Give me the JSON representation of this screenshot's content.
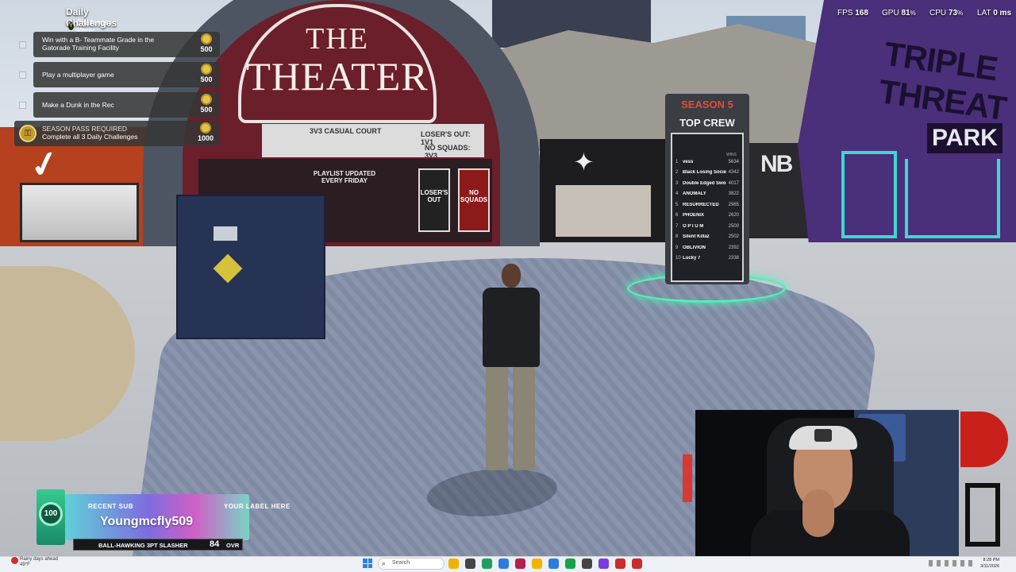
{
  "challenges": {
    "title": "Daily Challenges",
    "menu_button": "Y",
    "menu_label": "Challenges Menu",
    "items": [
      {
        "line1": "Win with a B- Teammate Grade in the",
        "line2": "Gatorade Training Facility",
        "reward": "500"
      },
      {
        "line1": "Play a multiplayer game",
        "line2": "",
        "reward": "500"
      },
      {
        "line1": "Make a Dunk in the Rec",
        "line2": "",
        "reward": "500"
      }
    ],
    "season_pass": {
      "title": "SEASON PASS REQUIRED",
      "description": "Complete all 3 Daily Challenges",
      "reward": "1000"
    }
  },
  "perf": {
    "fps_label": "FPS",
    "fps_value": "168",
    "gpu_label": "GPU",
    "gpu_value": "81",
    "cpu_label": "CPU",
    "cpu_value": "73",
    "lat_label": "LAT",
    "lat_value": "0",
    "percent": "%",
    "ms": "ms"
  },
  "scene": {
    "theater_the": "THE",
    "theater_name": "THEATER",
    "marquee_1": "3V3 CASUAL COURT",
    "marquee_2": "LOSER'S OUT: 1V1",
    "marquee_3": "NO SQUADS: 3V3",
    "playlist_1": "PLAYLIST UPDATED",
    "playlist_2": "EVERY FRIDAY",
    "poster_losers": "LOSER'S OUT",
    "poster_noscope": "NO SQUADS",
    "triple_threat": "TRIPLE THREAT",
    "park": "PARK",
    "nb_logo": "NB",
    "jordan_logo": "✦",
    "board_season": "SEASON 5",
    "board_title": "TOP CREW",
    "board_score_header": "WINS",
    "crews": [
      {
        "rank": "1",
        "name": "vess",
        "score": "5634"
      },
      {
        "rank": "2",
        "name": "Black Losing Society",
        "score": "4342"
      },
      {
        "rank": "3",
        "name": "Double Edged Sword",
        "score": "4017"
      },
      {
        "rank": "4",
        "name": "ANOMALY",
        "score": "3822"
      },
      {
        "rank": "5",
        "name": "RESURRECTED",
        "score": "2965"
      },
      {
        "rank": "6",
        "name": "PHOENIX",
        "score": "2620"
      },
      {
        "rank": "7",
        "name": "O P I U M",
        "score": "2500"
      },
      {
        "rank": "8",
        "name": "Silent Killaz",
        "score": "2502"
      },
      {
        "rank": "9",
        "name": "OBLIVION",
        "score": "2392"
      },
      {
        "rank": "10",
        "name": "Lucky 7",
        "score": "2338"
      }
    ]
  },
  "alert": {
    "badge": "100",
    "recent_sub": "RECENT SUB",
    "username": "Youngmcfly509",
    "your_label": "YOUR LABEL HERE",
    "player_build": "BALL-HAWKING 3PT SLASHER",
    "ovr_value": "84",
    "ovr_label": "OVR"
  },
  "taskbar": {
    "weather_line1": "Rainy days ahead",
    "weather_line2": "49°F",
    "search_placeholder": "Search",
    "time": "8:28 PM",
    "date": "3/11/2026",
    "icon_colors": [
      "#f0b400",
      "#444444",
      "#1f9e61",
      "#2d7be0",
      "#b81e4a",
      "#f0b400",
      "#2d7be0",
      "#15a34a",
      "#444444",
      "#7a3ce0",
      "#cc2b2b",
      "#cc2b2b"
    ]
  }
}
